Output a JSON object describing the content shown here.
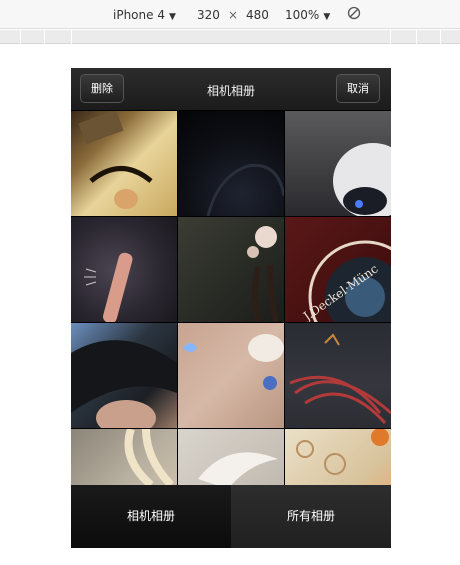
{
  "devtools": {
    "device": "iPhone 4",
    "width": "320",
    "times": "×",
    "height": "480",
    "zoom": "100%",
    "rotate_icon": "rotate-icon"
  },
  "album": {
    "title": "相机相册",
    "delete_label": "删除",
    "cancel_label": "取消",
    "tabs": [
      "相机相册",
      "所有相册"
    ],
    "active_tab": 0
  },
  "photos": [
    {
      "name": "photo-cartoon-face"
    },
    {
      "name": "photo-dark-reflection"
    },
    {
      "name": "photo-robot-eye"
    },
    {
      "name": "photo-brush-dark"
    },
    {
      "name": "photo-girl-roses"
    },
    {
      "name": "photo-camera-lens"
    },
    {
      "name": "photo-anime-hair"
    },
    {
      "name": "photo-anime-girl-blue-eye"
    },
    {
      "name": "photo-red-feathers"
    },
    {
      "name": "photo-blonde-hair"
    },
    {
      "name": "photo-white-wing"
    },
    {
      "name": "photo-floral-lace"
    }
  ]
}
